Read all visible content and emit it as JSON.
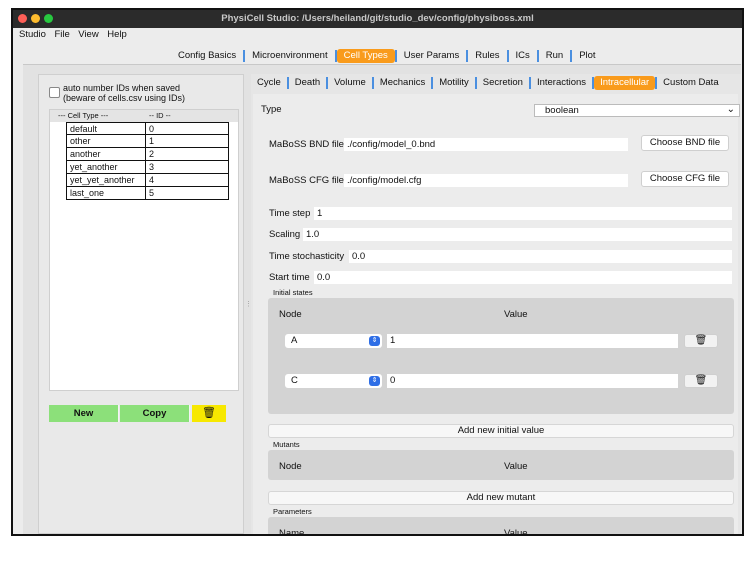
{
  "window": {
    "title": "PhysiCell Studio: /Users/heiland/git/studio_dev/config/physiboss.xml"
  },
  "menu": [
    "Studio",
    "File",
    "View",
    "Help"
  ],
  "main_tabs": [
    {
      "label": "Config Basics",
      "active": false
    },
    {
      "label": "Microenvironment",
      "active": false
    },
    {
      "label": "Cell Types",
      "active": true
    },
    {
      "label": "User Params",
      "active": false
    },
    {
      "label": "Rules",
      "active": false
    },
    {
      "label": "ICs",
      "active": false
    },
    {
      "label": "Run",
      "active": false
    },
    {
      "label": "Plot",
      "active": false
    }
  ],
  "left": {
    "checkbox_label": "auto number IDs when saved\n(beware of cells.csv using IDs)",
    "checkbox_checked": false,
    "table_header": {
      "name": "--- Cell Type ---",
      "id": "-- ID --"
    },
    "cell_types": [
      {
        "name": "default",
        "id": "0"
      },
      {
        "name": "other",
        "id": "1"
      },
      {
        "name": "another",
        "id": "2"
      },
      {
        "name": "yet_another",
        "id": "3"
      },
      {
        "name": "yet_yet_another",
        "id": "4"
      },
      {
        "name": "last_one",
        "id": "5"
      }
    ],
    "new_label": "New",
    "copy_label": "Copy",
    "delete_icon": "trash-icon"
  },
  "sub_tabs": [
    {
      "label": "Cycle",
      "active": false
    },
    {
      "label": "Death",
      "active": false
    },
    {
      "label": "Volume",
      "active": false
    },
    {
      "label": "Mechanics",
      "active": false
    },
    {
      "label": "Motility",
      "active": false
    },
    {
      "label": "Secretion",
      "active": false
    },
    {
      "label": "Interactions",
      "active": false
    },
    {
      "label": "Intracellular",
      "active": true
    },
    {
      "label": "Custom Data",
      "active": false
    }
  ],
  "intracellular": {
    "type_label": "Type",
    "type_value": "boolean",
    "bnd_label": "MaBoSS BND file",
    "bnd_value": "./config/model_0.bnd",
    "bnd_button": "Choose BND file",
    "cfg_label": "MaBoSS CFG file",
    "cfg_value": "./config/model.cfg",
    "cfg_button": "Choose CFG file",
    "time_step_label": "Time step",
    "time_step_value": "1",
    "scaling_label": "Scaling",
    "scaling_value": "1.0",
    "time_stoch_label": "Time stochasticity",
    "time_stoch_value": "0.0",
    "start_time_label": "Start time",
    "start_time_value": "0.0",
    "initial_states_title": "Initial states",
    "node_header": "Node",
    "value_header": "Value",
    "initial_states": [
      {
        "node": "A",
        "value": "1"
      },
      {
        "node": "C",
        "value": "0"
      }
    ],
    "add_initial_value": "Add new initial value",
    "mutants_title": "Mutants",
    "add_mutant": "Add new mutant",
    "parameters_title": "Parameters",
    "name_header": "Name"
  },
  "colors": {
    "active_tab": "#f99b1c",
    "green_button": "#8ce07a",
    "yellow_button": "#f7e800",
    "tab_separator": "#4a8fe0",
    "combo_arrows": "#2e6ee6"
  }
}
